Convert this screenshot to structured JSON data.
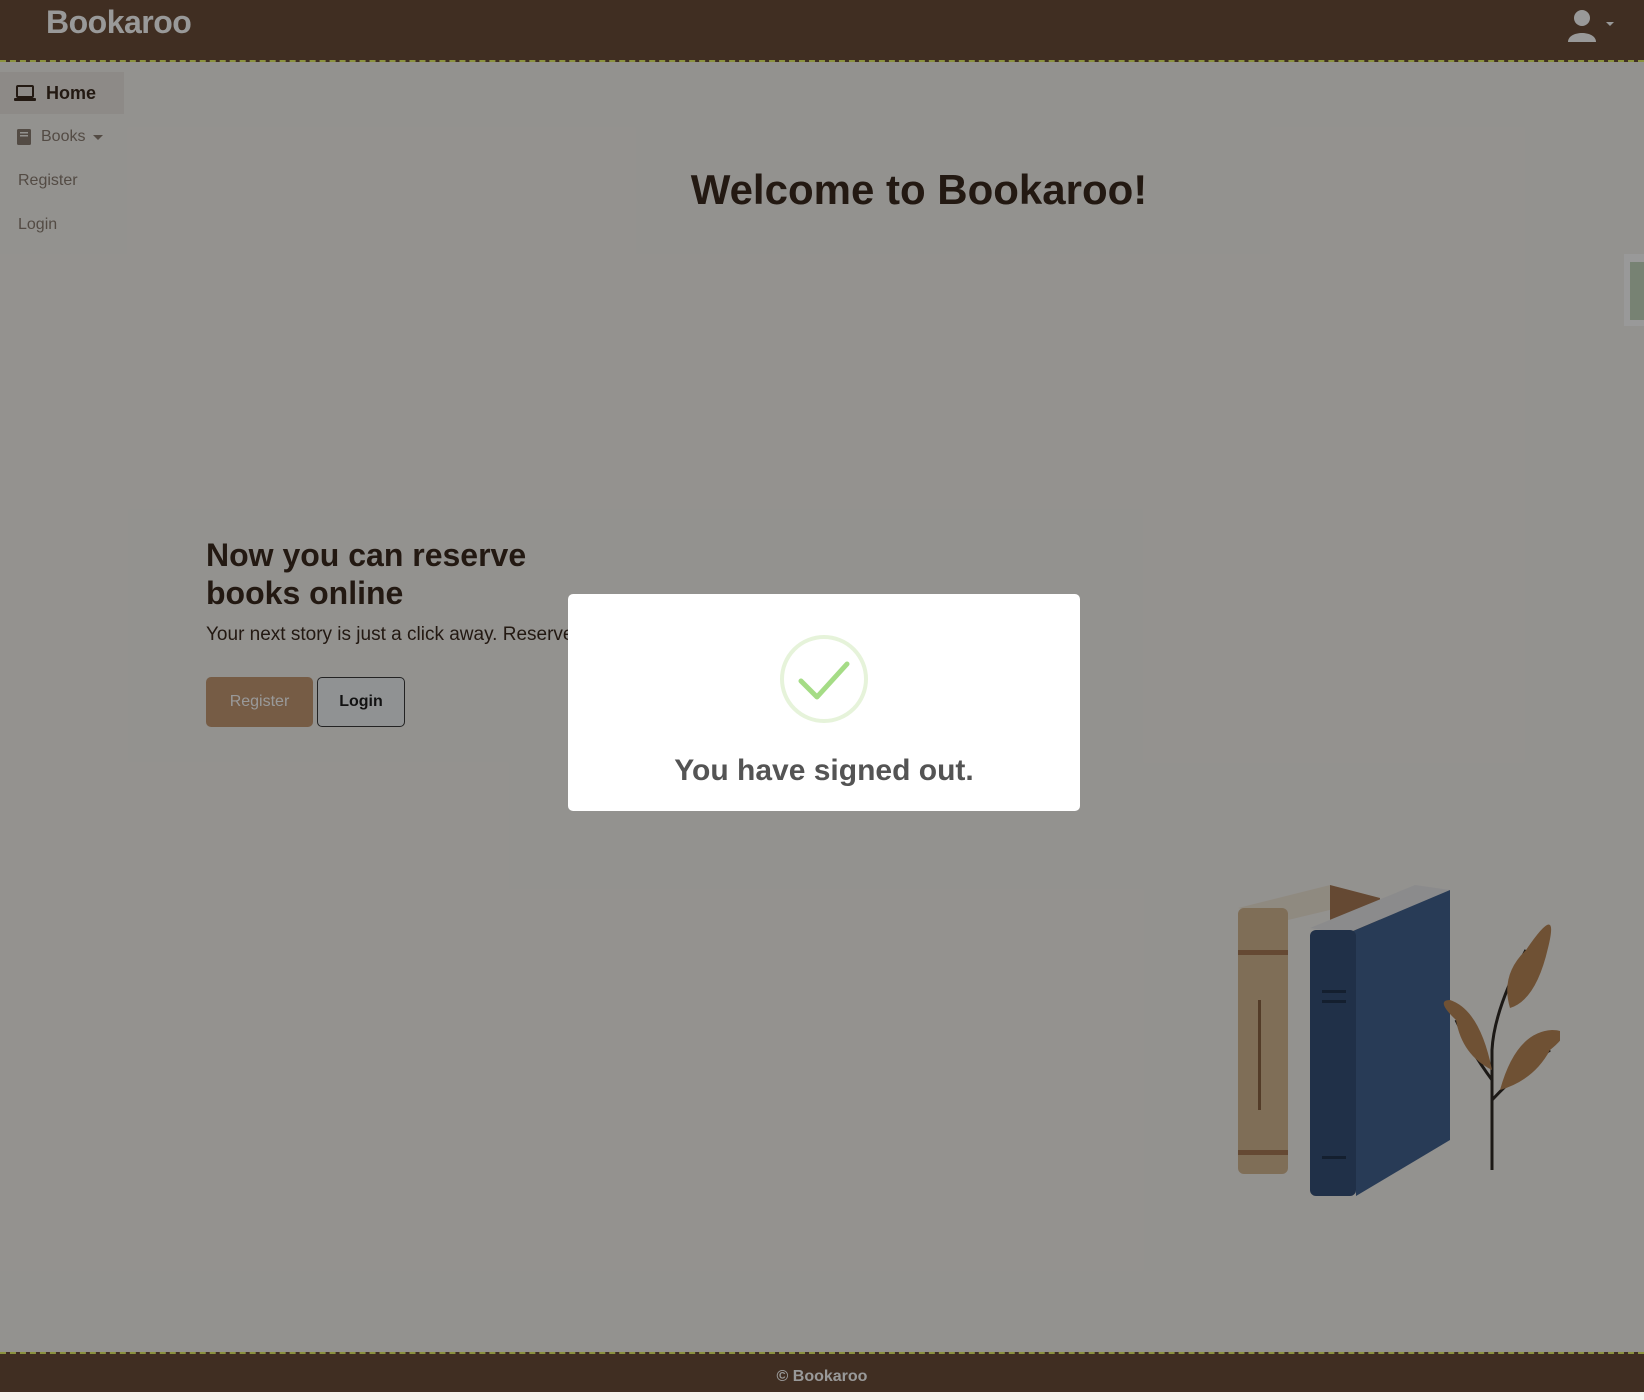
{
  "header": {
    "brand": "Bookaroo",
    "user_menu_icon": "user-icon"
  },
  "sidebar": {
    "items": [
      {
        "label": "Home",
        "icon": "laptop-icon",
        "active": true
      },
      {
        "label": "Books",
        "icon": "book-icon",
        "has_dropdown": true
      },
      {
        "label": "Register"
      },
      {
        "label": "Login"
      }
    ]
  },
  "main": {
    "welcome": "Welcome to Bookaroo!",
    "hero_title": "Now you can reserve books online",
    "hero_text": "Your next story is just a click away. Reserve",
    "register_button": "Register",
    "login_button": "Login"
  },
  "footer": {
    "text": "© Bookaroo"
  },
  "modal": {
    "icon": "check-circle-icon",
    "message": "You have signed out."
  },
  "colors": {
    "brand_bar": "#6b4e39",
    "accent_border": "#e8f36a",
    "primary_button": "#c59a73",
    "heading_text": "#3b2a1f",
    "success": "#a5dc86"
  }
}
